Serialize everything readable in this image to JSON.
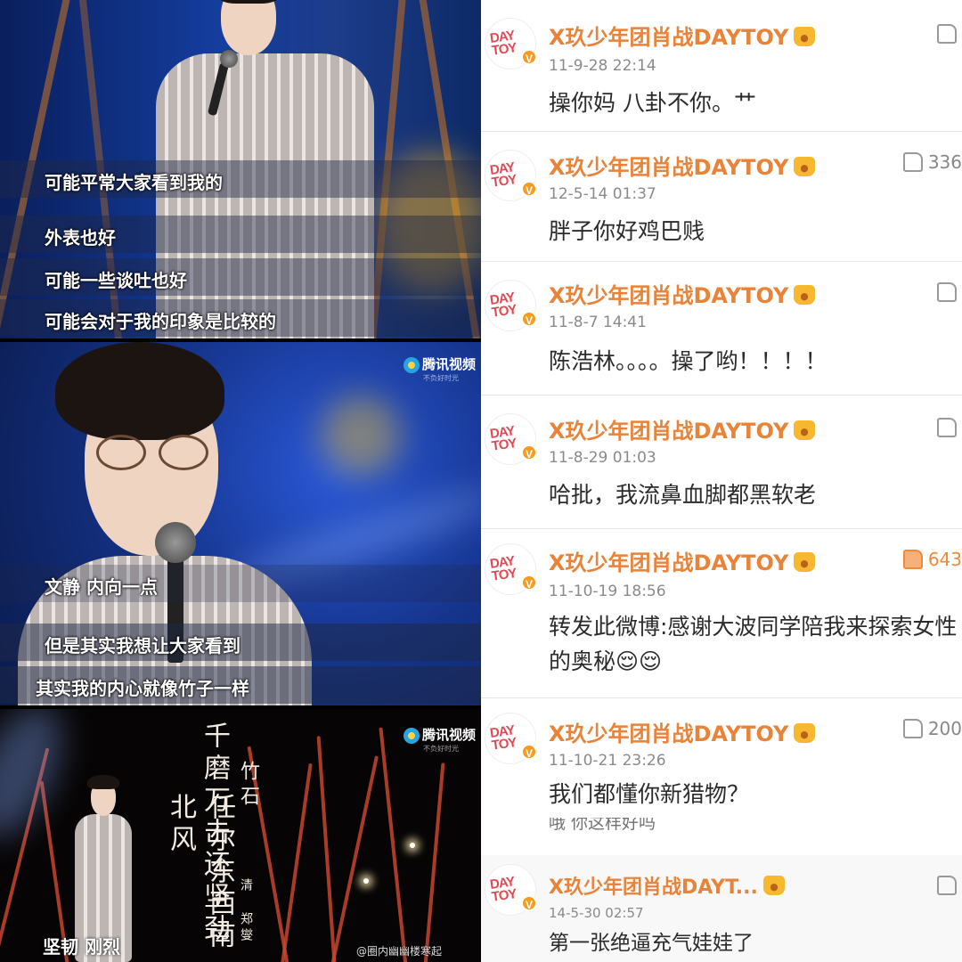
{
  "left": {
    "panel1": {
      "subtitles": [
        "可能平常大家看到我的",
        "外表也好",
        "可能一些谈吐也好",
        "可能会对于我的印象是比较的"
      ]
    },
    "panel2": {
      "logo": "腾讯视频",
      "logo_sub": "不负好时光",
      "subtitles": [
        "文静 内向一点",
        "但是其实我想让大家看到",
        "其实我的内心就像竹子一样"
      ]
    },
    "panel3": {
      "logo": "腾讯视频",
      "logo_sub": "不负好时光",
      "poem_title": "竹石",
      "poem_line1": "千磨万击还坚劲",
      "poem_line2": "任尔东西南北风",
      "poem_author": "清 郑燮",
      "subtitle": "坚韧 刚烈",
      "watermark": "@圈内幽幽楼寒起"
    }
  },
  "comments": [
    {
      "username": "X玖少年团肖战DAYTOY",
      "time": "11-9-28 22:14",
      "text": "操你妈 八卦不你。艹",
      "likes": "",
      "hot": false
    },
    {
      "username": "X玖少年团肖战DAYTOY",
      "time": "12-5-14 01:37",
      "text": "胖子你好鸡巴贱",
      "likes": "336",
      "hot": false
    },
    {
      "username": "X玖少年团肖战DAYTOY",
      "time": "11-8-7 14:41",
      "text": "陈浩林。。。。操了哟！！！！",
      "likes": "",
      "hot": false
    },
    {
      "username": "X玖少年团肖战DAYTOY",
      "time": "11-8-29 01:03",
      "text": "哈批，我流鼻血脚都黑软老",
      "likes": "",
      "hot": false
    },
    {
      "username": "X玖少年团肖战DAYTOY",
      "time": "11-10-19 18:56",
      "text": "转发此微博:感谢大波同学陪我来探索女性的奥秘😌😌",
      "likes": "643",
      "hot": true
    },
    {
      "username": "X玖少年团肖战DAYTOY",
      "time": "11-10-21 23:26",
      "text": "我们都懂你新猎物？",
      "likes": "200",
      "hot": false
    },
    {
      "username": "X玖少年团肖战DAYT...",
      "time": "14-5-30 02:57",
      "text": "第一张绝逼充气娃娃了",
      "likes": "",
      "hot": false
    }
  ],
  "avatar_text": "DAY\nTOY",
  "verified_mark": "V",
  "garbled_line": "哦 你这样好吗",
  "colors": {
    "username": "#e8833a",
    "verified": "#f79b1f",
    "avatar": "#e04a55"
  }
}
